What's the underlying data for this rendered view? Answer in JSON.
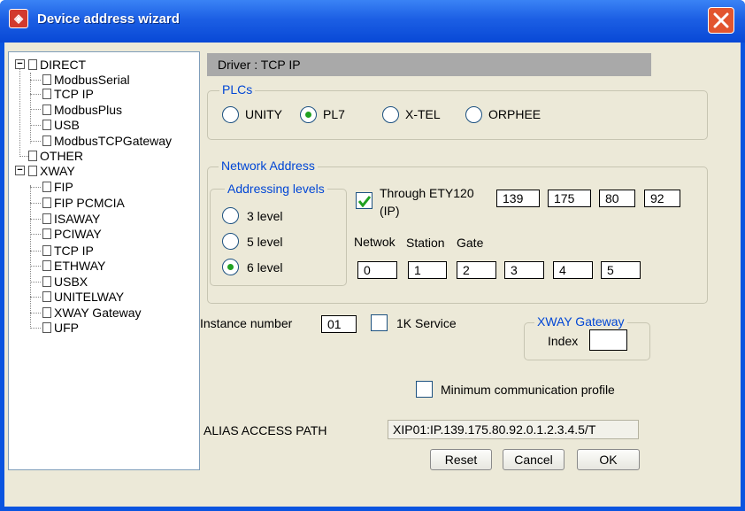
{
  "window": {
    "title": "Device address wizard"
  },
  "tree": {
    "nodes": [
      {
        "label": "DIRECT"
      },
      {
        "label": "ModbusSerial"
      },
      {
        "label": "TCP IP"
      },
      {
        "label": "ModbusPlus"
      },
      {
        "label": "USB"
      },
      {
        "label": "ModbusTCPGateway"
      },
      {
        "label": "OTHER"
      },
      {
        "label": "XWAY"
      },
      {
        "label": "FIP"
      },
      {
        "label": "FIP PCMCIA"
      },
      {
        "label": "ISAWAY"
      },
      {
        "label": "PCIWAY"
      },
      {
        "label": "TCP IP"
      },
      {
        "label": "ETHWAY"
      },
      {
        "label": "USBX"
      },
      {
        "label": "UNITELWAY"
      },
      {
        "label": "XWAY Gateway"
      },
      {
        "label": "UFP"
      }
    ]
  },
  "driver": {
    "label": "Driver : TCP IP"
  },
  "plcs": {
    "title": "PLCs",
    "options": [
      "UNITY",
      "PL7",
      "X-TEL",
      "ORPHEE"
    ],
    "selected": "PL7"
  },
  "network": {
    "title": "Network Address",
    "addressing": {
      "title": "Addressing levels",
      "options": [
        "3 level",
        "5 level",
        "6 level"
      ],
      "selected": "6 level"
    },
    "through_label": "Through ETY120",
    "through_label2": "(IP)",
    "through_checked": true,
    "ip": [
      "139",
      "175",
      "80",
      "92"
    ],
    "col_labels": {
      "netwok": "Netwok",
      "station": "Station",
      "gate": "Gate"
    },
    "levels": [
      "0",
      "1",
      "2",
      "3",
      "4",
      "5"
    ]
  },
  "instance": {
    "label": "Instance number",
    "value": "01"
  },
  "service_1k": {
    "label": "1K Service",
    "checked": false
  },
  "xway_gateway": {
    "title": "XWAY Gateway",
    "index_label": "Index",
    "index_value": ""
  },
  "min_profile": {
    "label": "Minimum communication profile",
    "checked": false
  },
  "alias": {
    "label": "ALIAS ACCESS PATH",
    "value": "XIP01:IP.139.175.80.92.0.1.2.3.4.5/T"
  },
  "buttons": {
    "reset": "Reset",
    "cancel": "Cancel",
    "ok": "OK"
  },
  "colors": {
    "title_bar": "#1c5fe4",
    "close": "#e2552f",
    "legend": "#0046d5",
    "radio_dot": "#21a121",
    "check": "#21a121"
  }
}
